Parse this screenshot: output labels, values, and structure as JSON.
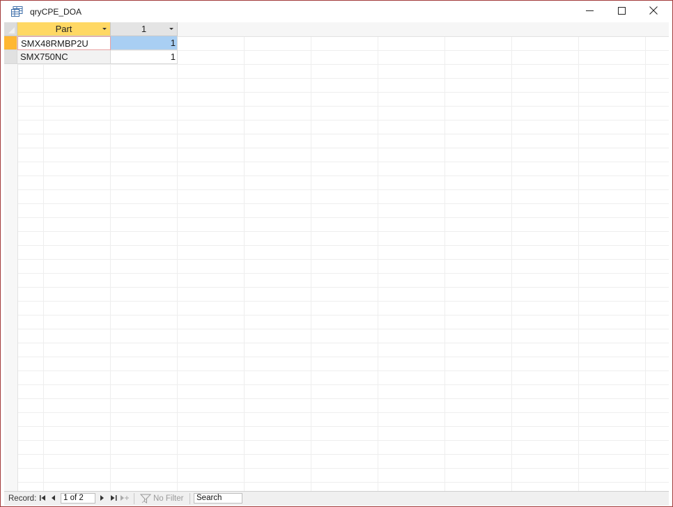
{
  "window": {
    "title": "qryCPE_DOA",
    "icon": "query-datasheet-icon"
  },
  "columns": [
    {
      "label": "Part"
    },
    {
      "label": "1"
    }
  ],
  "rows": [
    {
      "part": "SMX48RMBP2U",
      "value": "1"
    },
    {
      "part": "SMX750NC",
      "value": "1"
    }
  ],
  "status": {
    "record_label": "Record:",
    "record_position": "1 of 2",
    "filter_label": "No Filter",
    "search_placeholder": "Search"
  },
  "colors": {
    "accent_header": "#ffd864",
    "selected_cell": "#a9cff3",
    "active_row_marker": "#ffb733",
    "window_border": "#a23b3b"
  }
}
